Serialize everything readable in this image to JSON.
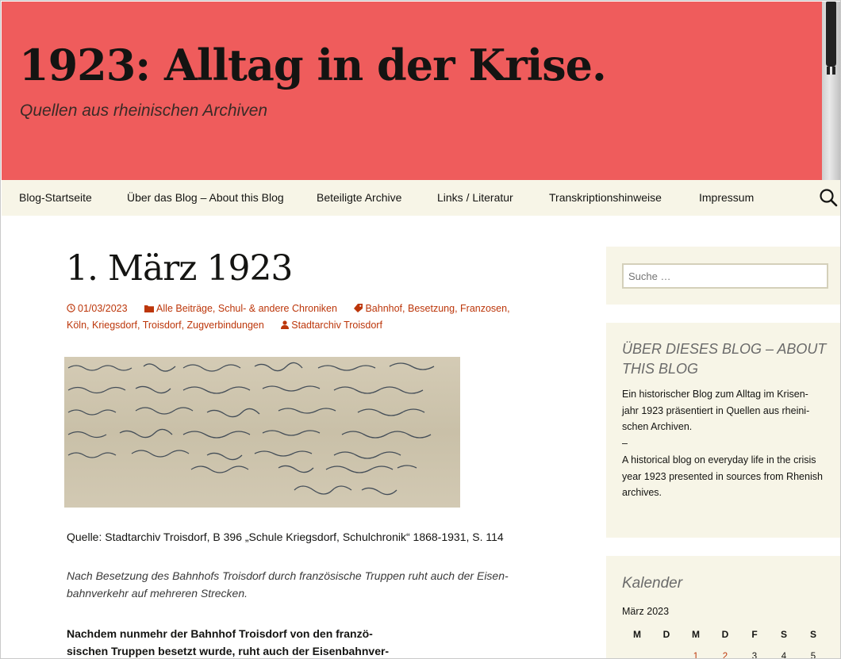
{
  "header": {
    "title": "1923: Alltag in der Krise.",
    "description": "Quellen aus rheinischen Archiven"
  },
  "nav": {
    "items": [
      {
        "label": "Blog-Startseite"
      },
      {
        "label": "Über das Blog – About this Blog"
      },
      {
        "label": "Beteiligte Archive"
      },
      {
        "label": "Links / Literatur"
      },
      {
        "label": "Transkriptionshinweise"
      },
      {
        "label": "Impressum"
      }
    ],
    "search_icon": "search-icon"
  },
  "post": {
    "title": "1. März 1923",
    "date": "01/03/2023",
    "categories": [
      "Alle Beiträge",
      "Schul- & andere Chroniken"
    ],
    "tags_line1": [
      "Bahnhof",
      "Besetzung",
      "Franzosen"
    ],
    "tags_line2": [
      "Köln",
      "Kriegsdorf",
      "Troisdorf",
      "Zugverbindungen"
    ],
    "author": "Stadtarchiv Troisdorf",
    "image_alt": "Handschriftlicher Eintrag aus der Schulchronik Kriegsdorf",
    "caption": "Quelle: Stadtarchiv Troisdorf, B 396 „Schule Kriegsdorf, Schulchronik“ 1868-1931, S. 114",
    "lead_line1": "Nach Besetzung des Bahnhofs Troisdorf durch französische Truppen ruht auch der Eisen-",
    "lead_line2": "bahnverkehr auf mehreren Strecken.",
    "bold_line1": "Nachdem nunmehr der Bahnhof Troisdorf von den franzö-",
    "bold_line2": "sischen Truppen besetzt wurde, ruht auch der Eisenbahnver-"
  },
  "sidebar": {
    "search_placeholder": "Suche …",
    "about": {
      "title": "ÜBER DIESES BLOG – ABOUT THIS BLOG",
      "de_line1": "Ein historischer Blog zum Alltag im Krisen-",
      "de_line2": "jahr 1923 präsentiert in Quellen aus rheini-",
      "de_line3": "schen Archiven.",
      "separator": "–",
      "en_line1": "A historical blog on everyday life in the crisis",
      "en_line2": "year 1923 presented in sources from Rhenish",
      "en_line3": "archives."
    },
    "calendar": {
      "title": "Kalender",
      "caption": "März 2023",
      "weekdays": [
        "M",
        "D",
        "M",
        "D",
        "F",
        "S",
        "S"
      ],
      "first_row": [
        "",
        "",
        "1",
        "2",
        "3",
        "4",
        "5"
      ]
    }
  },
  "colors": {
    "header_bg": "#ef5c5c",
    "nav_bg": "#f7f5e7",
    "link": "#bc360a"
  }
}
